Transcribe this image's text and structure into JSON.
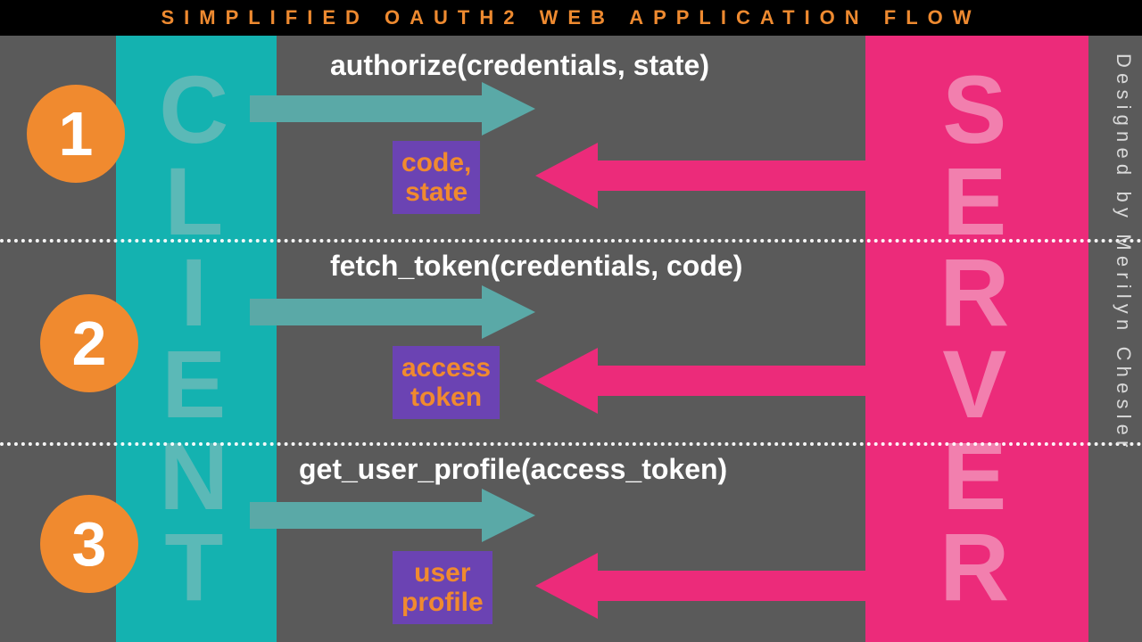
{
  "title": "SIMPLIFIED OAUTH2 WEB APPLICATION FLOW",
  "lanes": {
    "client": "CLIENT",
    "server": "SERVER"
  },
  "credit": "Designed by Merilyn Chesler",
  "steps": [
    {
      "num": "1",
      "call": "authorize(credentials, state)",
      "ret1": "code,",
      "ret2": "state"
    },
    {
      "num": "2",
      "call": "fetch_token(credentials, code)",
      "ret1": "access",
      "ret2": "token"
    },
    {
      "num": "3",
      "call": "get_user_profile(access_token)",
      "ret1": "user",
      "ret2": "profile"
    }
  ],
  "colors": {
    "bg": "#5a5a5a",
    "title_bg": "#000000",
    "title_fg": "#ee8a30",
    "client": "#14b2b0",
    "client_txt": "#5bb9b7",
    "server": "#ec2b7a",
    "server_txt": "#f27fae",
    "badge": "#f08a2f",
    "ret_bg": "#6b43b3",
    "arrow_fwd": "#5aa9a7",
    "arrow_back": "#ec2b7a"
  }
}
